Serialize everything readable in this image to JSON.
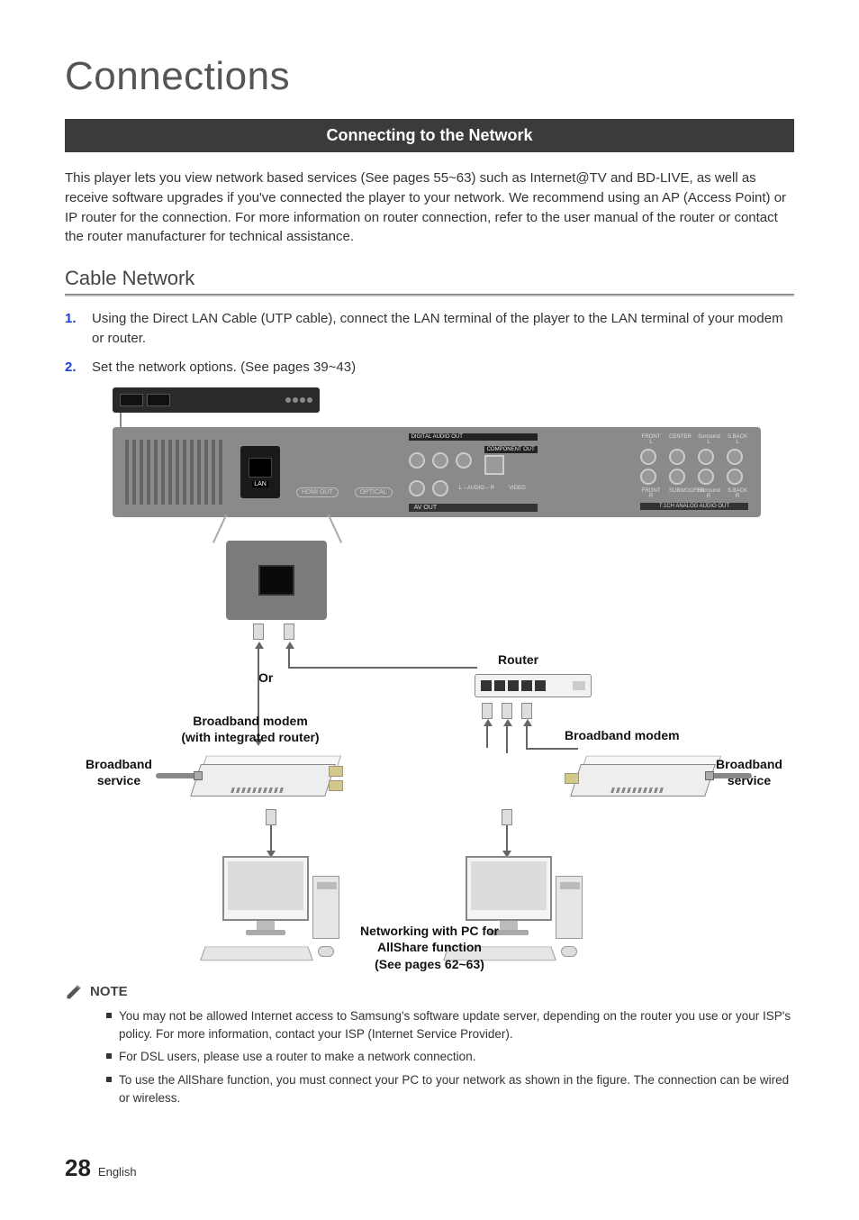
{
  "page": {
    "title": "Connections",
    "section_bar": "Connecting to the Network",
    "intro": "This player lets you view network based services (See pages 55~63) such as Internet@TV and BD-LIVE, as well as receive software upgrades if you've connected the player to your network. We recommend using an AP (Access Point) or IP router for the connection. For more information on router connection, refer to the user manual of the router or contact the router manufacturer for technical assistance.",
    "subhead": "Cable Network",
    "steps": [
      {
        "num": "1.",
        "text": "Using the Direct LAN Cable (UTP cable), connect the LAN terminal of the player to the LAN terminal of your modem or router."
      },
      {
        "num": "2.",
        "text": "Set the network options. (See pages 39~43)"
      }
    ],
    "diagram": {
      "back_panel": {
        "lan": "LAN",
        "hdmi_out": "HDMI OUT",
        "optical": "OPTICAL",
        "digital_audio_out": "DIGITAL AUDIO OUT",
        "component_out": "COMPONENT OUT",
        "av_out": "AV OUT",
        "analog_out": "7.1CH ANALOG AUDIO OUT",
        "ch_front_l": "FRONT L",
        "ch_center": "CENTER",
        "ch_surround_l": "Surround L",
        "ch_s_back_l": "S.BACK L",
        "ch_front_r": "FRONT R",
        "ch_subwoofer": "SUBWOOFER",
        "ch_surround_r": "Surround R",
        "ch_s_back_r": "S.BACK R",
        "video": "VIDEO",
        "audio_lr": "L – AUDIO – R"
      },
      "or": "Or",
      "router": "Router",
      "modem_integrated_l1": "Broadband modem",
      "modem_integrated_l2": "(with integrated router)",
      "modem_plain": "Broadband modem",
      "bb_service_left_l1": "Broadband",
      "bb_service_left_l2": "service",
      "bb_service_right_l1": "Broadband",
      "bb_service_right_l2": "service",
      "caption_l1": "Networking with PC for",
      "caption_l2": "AllShare function",
      "caption_l3": "(See pages 62~63)"
    },
    "note_label": "NOTE",
    "notes": [
      "You may not be allowed Internet access to Samsung's software update server, depending on the router you use or your ISP's policy. For more information, contact your ISP (Internet Service Provider).",
      "For DSL users, please use a router to make a network connection.",
      "To use the AllShare function, you must connect your PC to your network as shown in the figure. The connection can be wired or wireless."
    ],
    "page_number": "28",
    "language": "English"
  }
}
